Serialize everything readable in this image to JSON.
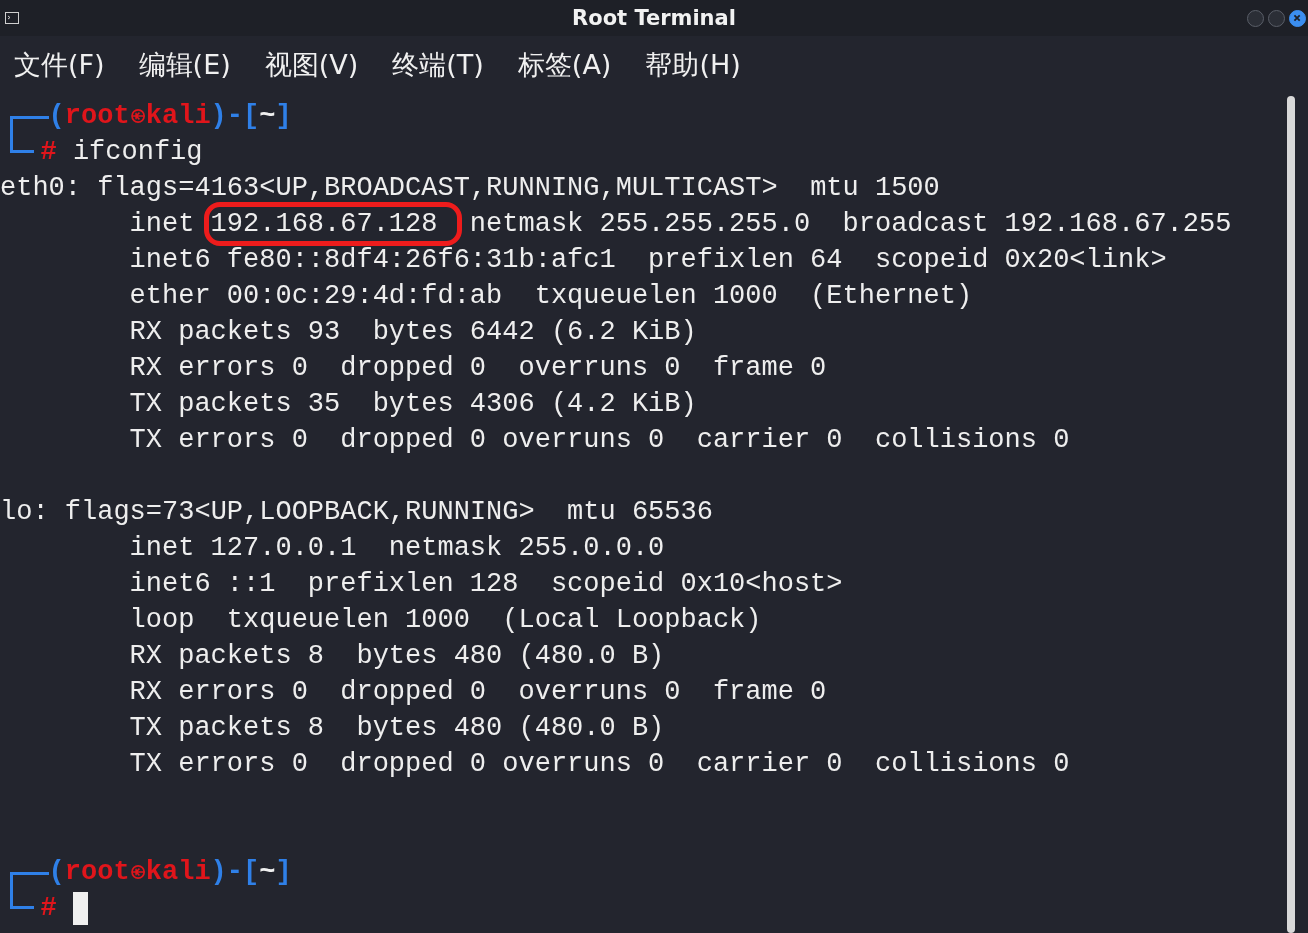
{
  "window": {
    "title": "Root Terminal"
  },
  "menu": [
    "文件(F)",
    "编辑(E)",
    "视图(V)",
    "终端(T)",
    "标签(A)",
    "帮助(H)"
  ],
  "blocks": [
    {
      "prompt": {
        "segments": [
          {
            "kind": "frame",
            "text": "("
          },
          {
            "kind": "user",
            "text": "root"
          },
          {
            "kind": "symbol"
          },
          {
            "kind": "user",
            "text": "kali"
          },
          {
            "kind": "frame",
            "text": ")-["
          },
          {
            "kind": "path",
            "text": "~"
          },
          {
            "kind": "frame",
            "text": "]"
          }
        ],
        "sign": "#",
        "command": "ifconfig"
      },
      "interfaces": [
        {
          "header": "eth0: flags=4163<UP,BROADCAST,RUNNING,MULTICAST>  mtu 1500",
          "details": [
            {
              "text": "inet 192.168.67.128  netmask 255.255.255.0  broadcast 192.168.67.255",
              "circled": true
            },
            {
              "text": "inet6 fe80::8df4:26f6:31b:afc1  prefixlen 64  scopeid 0x20<link>",
              "circled": false
            },
            {
              "text": "ether 00:0c:29:4d:fd:ab  txqueuelen 1000  (Ethernet)",
              "circled": false
            },
            {
              "text": "RX packets 93  bytes 6442 (6.2 KiB)",
              "circled": false
            },
            {
              "text": "RX errors 0  dropped 0  overruns 0  frame 0",
              "circled": false
            },
            {
              "text": "TX packets 35  bytes 4306 (4.2 KiB)",
              "circled": false
            },
            {
              "text": "TX errors 0  dropped 0 overruns 0  carrier 0  collisions 0",
              "circled": false
            }
          ]
        },
        {
          "header": "lo: flags=73<UP,LOOPBACK,RUNNING>  mtu 65536",
          "details": [
            {
              "text": "inet 127.0.0.1  netmask 255.0.0.0",
              "circled": false
            },
            {
              "text": "inet6 ::1  prefixlen 128  scopeid 0x10<host>",
              "circled": false
            },
            {
              "text": "loop  txqueuelen 1000  (Local Loopback)",
              "circled": false
            },
            {
              "text": "RX packets 8  bytes 480 (480.0 B)",
              "circled": false
            },
            {
              "text": "RX errors 0  dropped 0  overruns 0  frame 0",
              "circled": false
            },
            {
              "text": "TX packets 8  bytes 480 (480.0 B)",
              "circled": false
            },
            {
              "text": "TX errors 0  dropped 0 overruns 0  carrier 0  collisions 0",
              "circled": false
            }
          ]
        }
      ]
    },
    {
      "prompt": {
        "segments": [
          {
            "kind": "frame",
            "text": "("
          },
          {
            "kind": "user",
            "text": "root"
          },
          {
            "kind": "symbol"
          },
          {
            "kind": "user",
            "text": "kali"
          },
          {
            "kind": "frame",
            "text": ")-["
          },
          {
            "kind": "path",
            "text": "~"
          },
          {
            "kind": "frame",
            "text": "]"
          }
        ],
        "sign": "#",
        "cursor": true
      }
    }
  ]
}
